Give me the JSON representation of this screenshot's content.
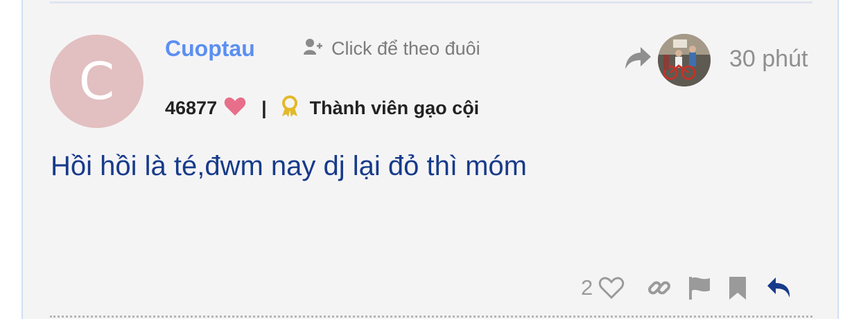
{
  "post": {
    "avatar_letter": "C",
    "username": "Cuoptau",
    "follow_label": "Click để theo đuôi",
    "score": "46877",
    "rank_title": "Thành viên gạo cội",
    "time": "30 phút",
    "content": "Hồi hồi là té,đwm nay dj lại đỏ thì móm",
    "like_count": "2"
  },
  "colors": {
    "username": "#5b8ff1",
    "content": "#173b8a",
    "heart": "#e76f8a",
    "badge": "#e3b92a",
    "avatar_bg": "#e2bfc0",
    "reply": "#173b8a"
  },
  "icons": [
    "add-user-icon",
    "heart-icon",
    "award-badge-icon",
    "share-arrow-icon",
    "heart-outline-icon",
    "link-icon",
    "flag-icon",
    "bookmark-icon",
    "reply-icon"
  ]
}
